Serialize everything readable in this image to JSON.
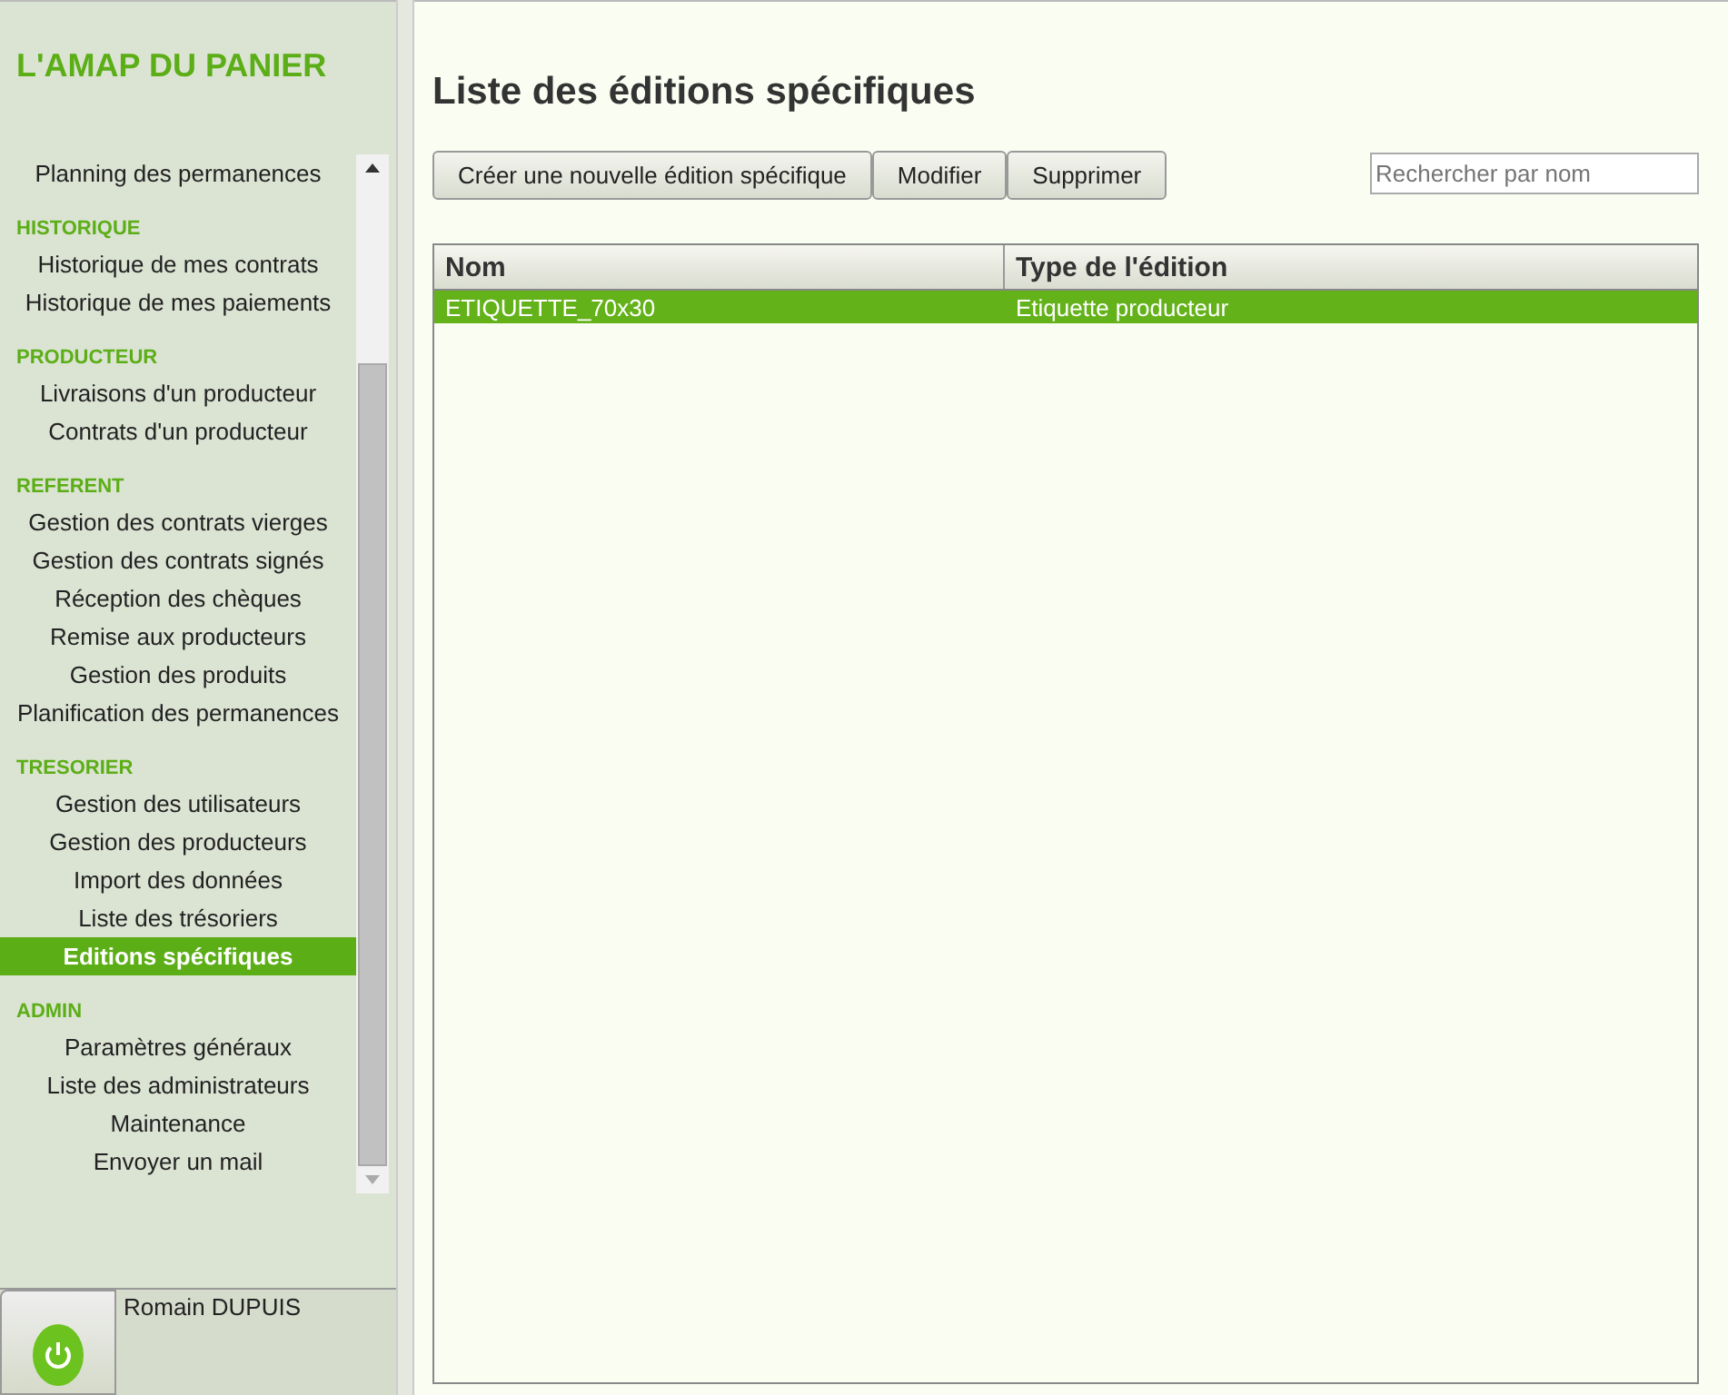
{
  "app_title": "L'AMAP DU PANIER",
  "menu": [
    {
      "items": [
        {
          "label": "Planning des permanences",
          "selected": false
        }
      ]
    },
    {
      "heading": "HISTORIQUE",
      "items": [
        {
          "label": "Historique de mes contrats",
          "selected": false
        },
        {
          "label": "Historique de mes paiements",
          "selected": false
        }
      ]
    },
    {
      "heading": "PRODUCTEUR",
      "items": [
        {
          "label": "Livraisons d'un producteur",
          "selected": false
        },
        {
          "label": "Contrats d'un producteur",
          "selected": false
        }
      ]
    },
    {
      "heading": "REFERENT",
      "items": [
        {
          "label": "Gestion des contrats vierges",
          "selected": false
        },
        {
          "label": "Gestion des contrats signés",
          "selected": false
        },
        {
          "label": "Réception des chèques",
          "selected": false
        },
        {
          "label": "Remise aux producteurs",
          "selected": false
        },
        {
          "label": "Gestion des produits",
          "selected": false
        },
        {
          "label": "Planification des permanences",
          "selected": false
        }
      ]
    },
    {
      "heading": "TRESORIER",
      "items": [
        {
          "label": "Gestion des utilisateurs",
          "selected": false
        },
        {
          "label": "Gestion des producteurs",
          "selected": false
        },
        {
          "label": "Import des données",
          "selected": false
        },
        {
          "label": "Liste des trésoriers",
          "selected": false
        },
        {
          "label": "Editions spécifiques",
          "selected": true
        }
      ]
    },
    {
      "heading": "ADMIN",
      "items": [
        {
          "label": "Paramètres généraux",
          "selected": false
        },
        {
          "label": "Liste des administrateurs",
          "selected": false
        },
        {
          "label": "Maintenance",
          "selected": false
        },
        {
          "label": "Envoyer un mail",
          "selected": false
        }
      ]
    }
  ],
  "user": {
    "name": "Romain DUPUIS"
  },
  "page_title": "Liste des éditions spécifiques",
  "buttons": [
    "Créer une nouvelle édition spécifique",
    "Modifier",
    "Supprimer"
  ],
  "search": {
    "placeholder": "Rechercher par nom"
  },
  "table": {
    "columns": [
      "Nom",
      "Type de l'édition"
    ],
    "rows": [
      {
        "cells": [
          "ETIQUETTE_70x30",
          "Etiquette producteur"
        ],
        "selected": true
      }
    ]
  }
}
